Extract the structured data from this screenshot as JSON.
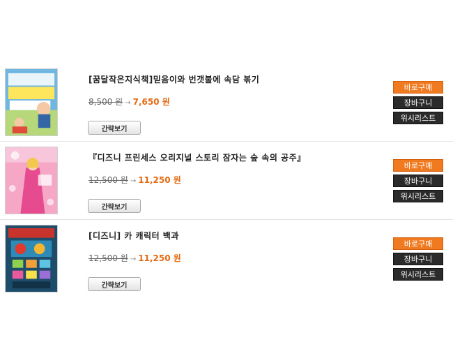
{
  "products": [
    {
      "title": "[꿈달작은지식책]믿음이와 번갯불에 속담 볶기",
      "original_price": "8,500 원",
      "sale_price": "7,650 원",
      "cover_text": "믿음이와 번갯불에 속담 볶기",
      "quick_view_label": "간략보기",
      "buy_label": "바로구매",
      "cart_label": "장바구니",
      "wishlist_label": "위시리스트"
    },
    {
      "title": "『디즈니 프린세스 오리지널 스토리 잠자는 숲 속의 공주』",
      "original_price": "12,500 원",
      "sale_price": "11,250 원",
      "cover_text": "잠자는 숲속의 공주",
      "quick_view_label": "간략보기",
      "buy_label": "바로구매",
      "cart_label": "장바구니",
      "wishlist_label": "위시리스트"
    },
    {
      "title": "[디즈니] 카 캐릭터 백과",
      "original_price": "12,500 원",
      "sale_price": "11,250 원",
      "cover_text": "Cars",
      "quick_view_label": "간략보기",
      "buy_label": "바로구매",
      "cart_label": "장바구니",
      "wishlist_label": "위시리스트"
    }
  ],
  "colors": {
    "accent": "#f07a1f",
    "sale_price": "#e66a12",
    "dark_button": "#2b2b2b"
  },
  "icons": {
    "price_arrow": "arrow-right-icon"
  }
}
